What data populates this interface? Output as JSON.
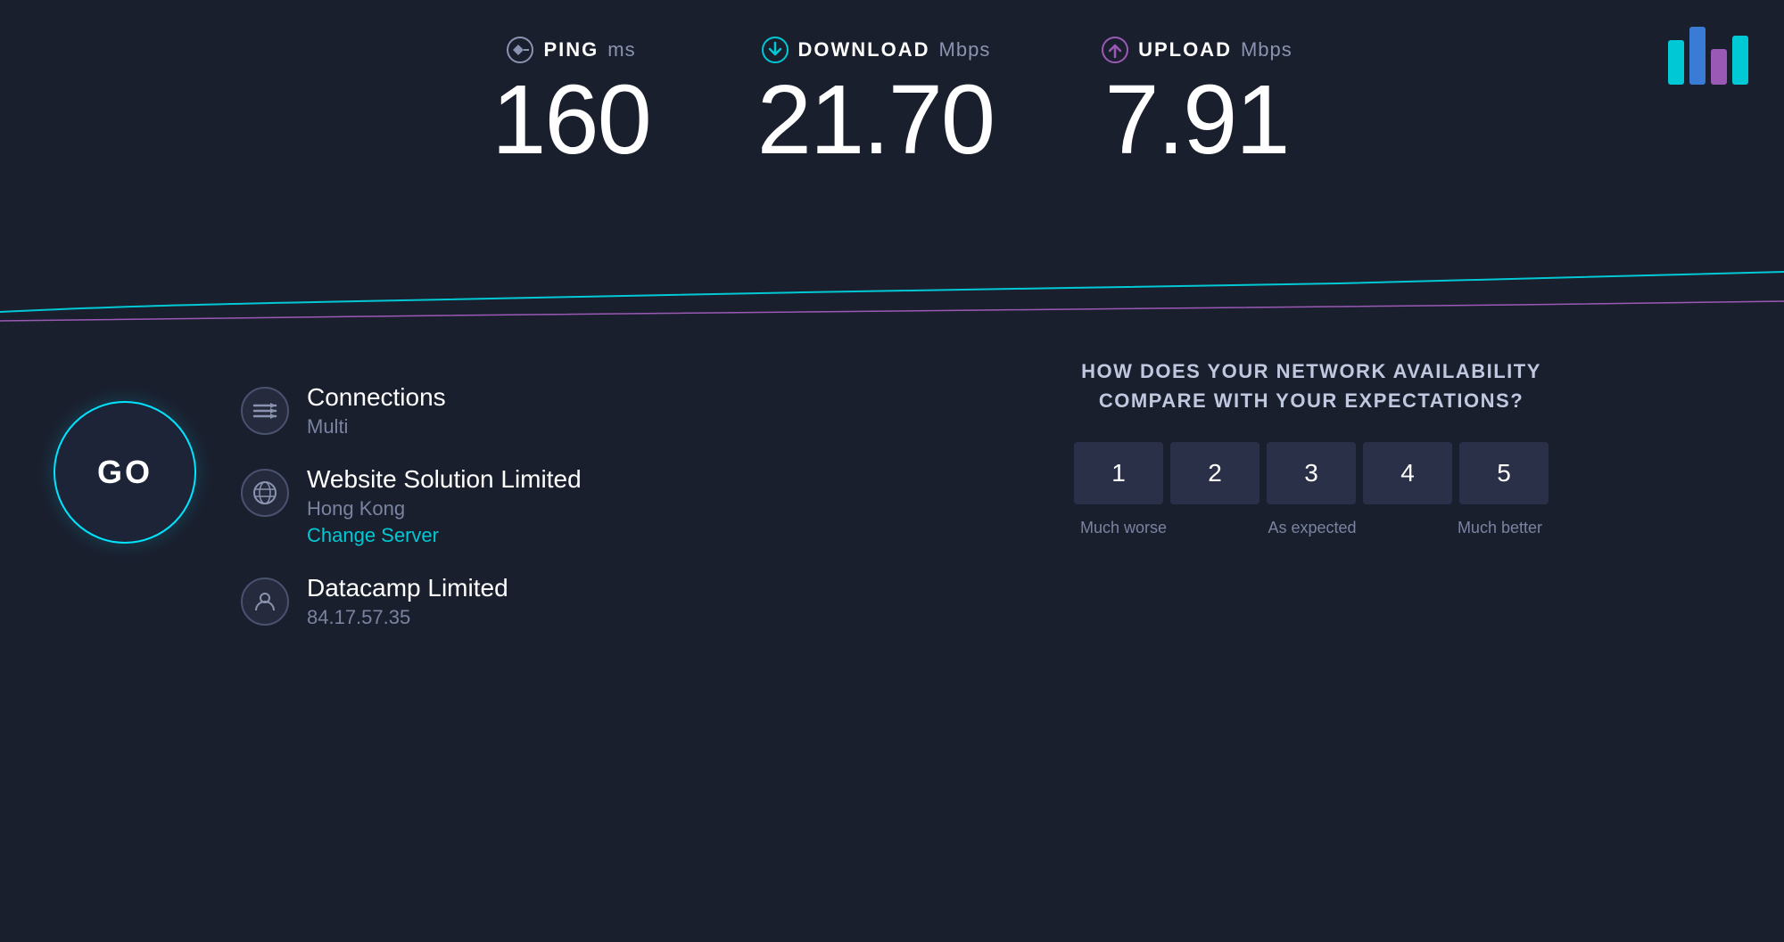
{
  "header": {
    "ping": {
      "label": "PING",
      "unit": "ms",
      "value": "160"
    },
    "download": {
      "label": "DOWNLOAD",
      "unit": "Mbps",
      "value": "21.70"
    },
    "upload": {
      "label": "UPLOAD",
      "unit": "Mbps",
      "value": "7.91"
    }
  },
  "go_button": {
    "label": "GO"
  },
  "connections": {
    "label": "Connections",
    "value": "Multi"
  },
  "isp": {
    "label": "Website Solution Limited",
    "location": "Hong Kong",
    "change_server": "Change Server"
  },
  "client": {
    "label": "Datacamp Limited",
    "ip": "84.17.57.35"
  },
  "survey": {
    "question": "HOW DOES YOUR NETWORK AVAILABILITY COMPARE WITH YOUR EXPECTATIONS?",
    "ratings": [
      "1",
      "2",
      "3",
      "4",
      "5"
    ],
    "label_left": "Much worse",
    "label_center": "As expected",
    "label_right": "Much better"
  },
  "colors": {
    "accent_cyan": "#00c8d4",
    "accent_purple": "#9b59b6",
    "bg_dark": "#1a1f2e",
    "bg_mid": "#252b3d",
    "text_muted": "#7a84a0"
  }
}
